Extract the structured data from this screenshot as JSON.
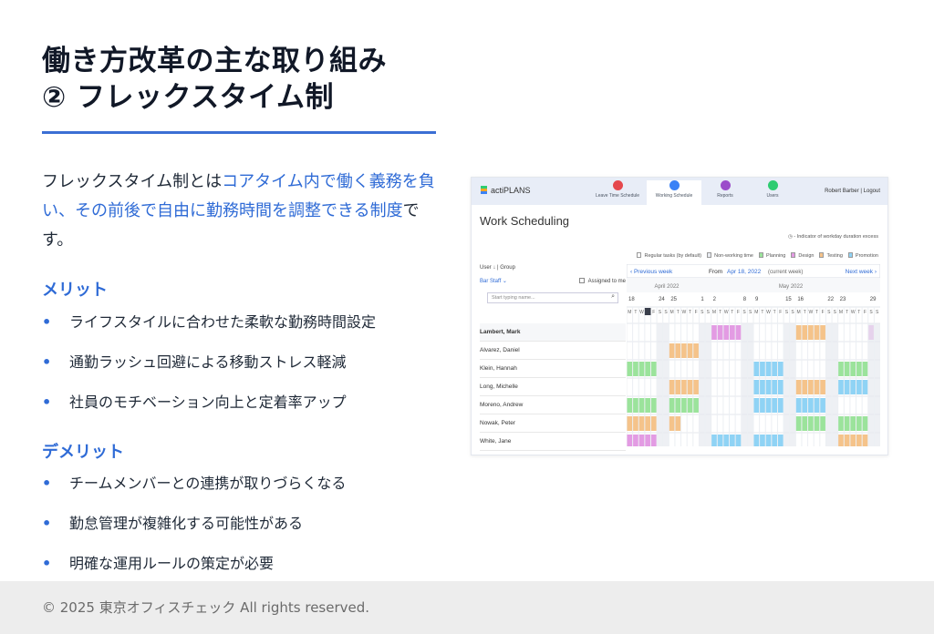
{
  "title": {
    "line1": "働き方改革の主な取り組み",
    "line2": "② フレックスタイム制"
  },
  "intro": {
    "part1": "フレックスタイム制とは",
    "highlight": "コアタイム内で働く義務を負い、その前後で自由に勤務時間を調整できる制度",
    "part2": "です。"
  },
  "merits": {
    "label": "メリット",
    "items": [
      "ライフスタイルに合わせた柔軟な勤務時間設定",
      "通勤ラッシュ回避による移動ストレス軽減",
      "社員のモチベーション向上と定着率アップ"
    ]
  },
  "demerits": {
    "label": "デメリット",
    "items": [
      "チームメンバーとの連携が取りづらくなる",
      "勤怠管理が複雑化する可能性がある",
      "明確な運用ルールの策定が必要"
    ]
  },
  "bullet_glyph": "•",
  "footer": "© 2025 東京オフィスチェック All rights reserved.",
  "colors": {
    "accent": "#2f6bd6",
    "rule": "#3b6fd4"
  },
  "screenshot": {
    "app_name": "actiPLANS",
    "nav": [
      {
        "label": "Leave Time Schedule",
        "color": "#e5484d"
      },
      {
        "label": "Working Schedule",
        "color": "#3b82f6"
      },
      {
        "label": "Reports",
        "color": "#9b4dca"
      },
      {
        "label": "Users",
        "color": "#2ecc71"
      }
    ],
    "user_links": "Robert Barber  |  Logout",
    "page_title": "Work Scheduling",
    "indicator_text": "◷ - Indicator of workday duration excess",
    "legend": [
      {
        "label": "Regular tasks (by default)",
        "color": "#ffffff"
      },
      {
        "label": "Non-working time",
        "color": "#e7eaf0"
      },
      {
        "label": "Planning",
        "color": "#9be39b"
      },
      {
        "label": "Design",
        "color": "#e39be3"
      },
      {
        "label": "Testing",
        "color": "#f5c38a"
      },
      {
        "label": "Promotion",
        "color": "#8fd3f5"
      }
    ],
    "user_sort": "User ↓  |  Group",
    "filter": "Bar Staff ⌄",
    "assigned_to_me": "Assigned to me",
    "search_placeholder": "Start typing name...",
    "prev_week": "‹ Previous week",
    "from_label": "From",
    "from_date": "Apr 18, 2022",
    "current_week": "(current week)",
    "next_week": "Next week ›",
    "months": [
      "April 2022",
      "May 2022"
    ],
    "week_starts": [
      "18",
      "24",
      "25",
      "1",
      "2",
      "8",
      "9",
      "15",
      "16",
      "22",
      "23",
      "29"
    ],
    "day_letters": [
      "M",
      "T",
      "W",
      "T",
      "F",
      "S",
      "S"
    ],
    "names": [
      "Lambert, Mark",
      "Alvarez, Daniel",
      "Klein, Hannah",
      "Long, Michelle",
      "Moreno, Andrew",
      "Nowak, Peter",
      "White, Jane"
    ]
  }
}
